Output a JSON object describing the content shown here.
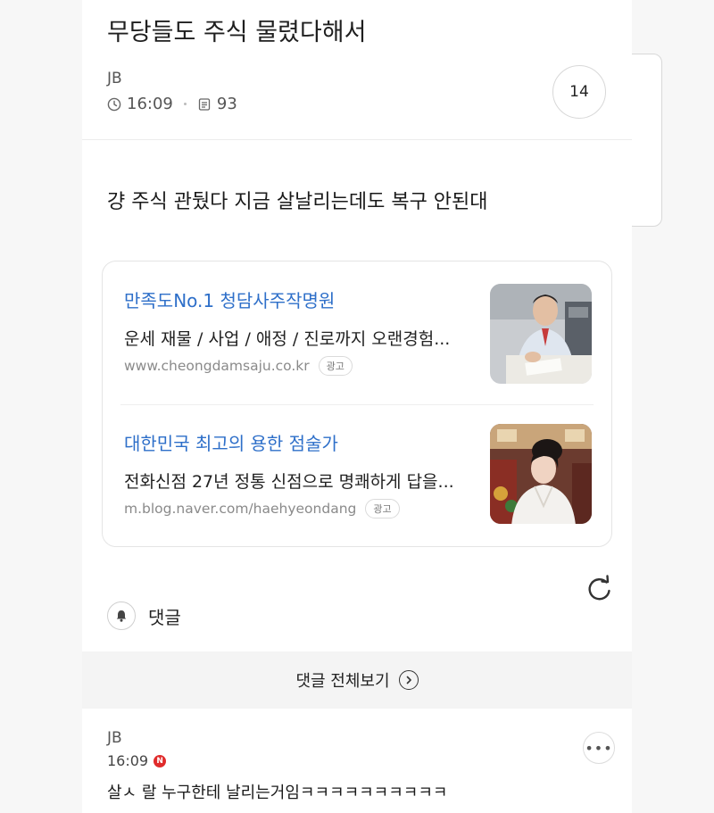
{
  "post": {
    "title": "무당들도 주식 물렸다해서",
    "author": "JB",
    "time": "16:09",
    "views": "93",
    "comment_count": "14",
    "body": "걍 주식 관뒀다 지금 살날리는데도 복구 안된대"
  },
  "ads": [
    {
      "title": "만족도No.1 청담사주작명원",
      "desc": "운세 재물 / 사업 / 애정 / 진로까지 오랜경험...",
      "url": "www.cheongdamsaju.co.kr",
      "tag": "광고",
      "thumb_icon": "man-at-desk-photo"
    },
    {
      "title": "대한민국 최고의 용한 점술가",
      "desc": "전화신점 27년 정통 신점으로 명쾌하게 답을...",
      "url": "m.blog.naver.com/haehyeondang",
      "tag": "광고",
      "thumb_icon": "woman-portrait-photo"
    }
  ],
  "comments_section": {
    "header": "댓글",
    "view_all": "댓글 전체보기",
    "items": [
      {
        "author": "JB",
        "time": "16:09",
        "badge": "N",
        "text": "살ㅅ 랄 누구한테 날리는거임ㅋㅋㅋㅋㅋㅋㅋㅋㅋㅋ"
      }
    ]
  },
  "colors": {
    "link_blue": "#2e6fc9",
    "badge_red": "#e02b2b",
    "background_side": "#f7f7f7"
  }
}
